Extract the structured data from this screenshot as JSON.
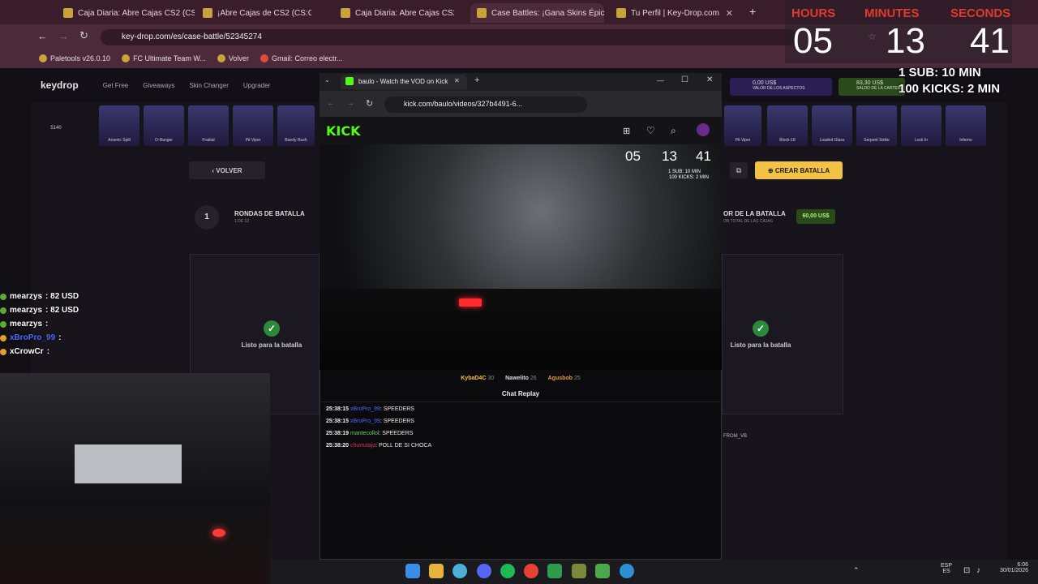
{
  "browser": {
    "tabs": [
      {
        "label": "Caja Diaria: Abre Cajas CS2 (CS",
        "active": false
      },
      {
        "label": "¡Abre Cajas de CS2 (CS:GO), Ge",
        "active": false
      },
      {
        "label": "Caja Diaria: Abre Cajas CS2 (CS",
        "active": false
      },
      {
        "label": "Case Battles: ¡Gana Skins Épico",
        "active": true
      },
      {
        "label": "Tu Perfil | Key-Drop.com",
        "active": false
      }
    ],
    "new_tab": "+",
    "url": "key-drop.com/es/case-battle/52345274",
    "bookmarks": [
      "Paletools v26.0.10",
      "FC Ultimate Team W...",
      "Volver",
      "Gmail: Correo electr..."
    ]
  },
  "keydrop": {
    "logo": "keydrop",
    "nav": [
      "Get Free",
      "Giveaways",
      "Skin Changer",
      "Upgrader"
    ],
    "balance_value": "5140",
    "skins_left": [
      "Arsenic Spill",
      "O-Ranger",
      "Fraktal",
      "Pit Viper",
      "Bandy Rush"
    ],
    "skins_right": [
      "Pit Viper",
      "Block-18",
      "Loaded Glass",
      "Serpent Strike",
      "Lock In",
      "Inferno"
    ],
    "aspects_value": "0,00 US$",
    "aspects_label": "VALOR DE LOS ASPECTOS",
    "balance_box_value": "83,30 US$",
    "balance_box_label": "SALDO DE LA CARTERA",
    "back_button": "VOLVER",
    "create_battle": "CREAR BATALLA",
    "round_number": "1",
    "rounds_label": "RONDAS DE BATALLA",
    "rounds_sub": "1 DE 12",
    "battle_value_label": "OR DE LA BATALLA",
    "battle_value_sub": "OR TOTAL DE LAS CAJAS",
    "battle_value": "60,00 US$",
    "ready_left": "Listo para la batalla",
    "ready_right": "Listo para la batalla",
    "player_name": "FROM_VB"
  },
  "kick": {
    "tab_title": "baulo - Watch the VOD on Kick",
    "url": "kick.com/baulo/videos/327b4491-6...",
    "logo": "KICK",
    "viewers": [
      {
        "name": "KybaD4C",
        "count": "30"
      },
      {
        "name": "Nawelito",
        "count": "26"
      },
      {
        "name": "Agusbob",
        "count": "25"
      }
    ],
    "chat_title": "Chat Replay",
    "chat": [
      {
        "time": "25:38:15",
        "user": "xBroPro_99",
        "text": ": SPEEDERS",
        "color": "#4a6cff"
      },
      {
        "time": "25:38:15",
        "user": "xBroPro_99",
        "text": ": SPEEDERS",
        "color": "#4a6cff"
      },
      {
        "time": "25:38:19",
        "user": "mantecollol",
        "text": ": SPEEDERS",
        "color": "#5fd36a"
      },
      {
        "time": "25:38:20",
        "user": "churrutajo",
        "text": ": POLL DE SI CHOCA",
        "color": "#e0365a"
      }
    ],
    "mini_timer": {
      "hours": "05",
      "minutes": "13",
      "seconds": "41",
      "sub": "1 SUB: 10 MIN",
      "kicks": "100 KICKS: 2 MIN"
    }
  },
  "overlay_timer": {
    "hours_label": "HOURS",
    "minutes_label": "MINUTES",
    "seconds_label": "SECONDS",
    "hours": "05",
    "minutes": "13",
    "seconds": "41",
    "sub_rule": "1 SUB: 10 MIN",
    "kicks_rule": "100 KICKS: 2 MIN"
  },
  "stream_chat": [
    {
      "user": "mearzys",
      "text": ": 82 USD",
      "color": "#ffffff"
    },
    {
      "user": "mearzys",
      "text": ": 82 USD",
      "color": "#ffffff"
    },
    {
      "user": "mearzys",
      "text": ":",
      "color": "#ffffff"
    },
    {
      "user": "xBroPro_99",
      "text": ":",
      "color": "#4a6cff"
    },
    {
      "user": "xCrowCr",
      "text": ":",
      "color": "#ffffff"
    }
  ],
  "taskbar": {
    "lang": "ESP",
    "lang_sub": "ES",
    "time": "6:06",
    "date": "30/01/2026"
  },
  "colors": {
    "accent_gold": "#f3c242",
    "kick_green": "#53fc18",
    "timer_red": "#e23a2a"
  }
}
